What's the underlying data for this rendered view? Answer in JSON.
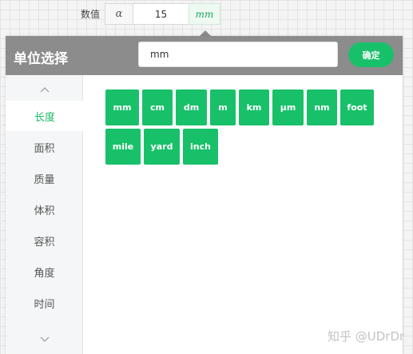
{
  "value_row": {
    "label": "数值",
    "alpha_symbol": "α",
    "value": "15",
    "unit_display": "mm"
  },
  "popup": {
    "title": "单位选择",
    "search_value": "mm",
    "confirm_label": "确定"
  },
  "sidebar": {
    "items": [
      {
        "label": "长度",
        "active": true
      },
      {
        "label": "面积",
        "active": false
      },
      {
        "label": "质量",
        "active": false
      },
      {
        "label": "体积",
        "active": false
      },
      {
        "label": "容积",
        "active": false
      },
      {
        "label": "角度",
        "active": false
      },
      {
        "label": "时间",
        "active": false
      }
    ]
  },
  "units": [
    "mm",
    "cm",
    "dm",
    "m",
    "km",
    "μm",
    "nm",
    "foot",
    "mile",
    "yard",
    "inch"
  ],
  "colors": {
    "accent_green": "#19c06a",
    "header_gray": "#8c8c8c"
  },
  "watermark": "知乎 @UDrDr"
}
